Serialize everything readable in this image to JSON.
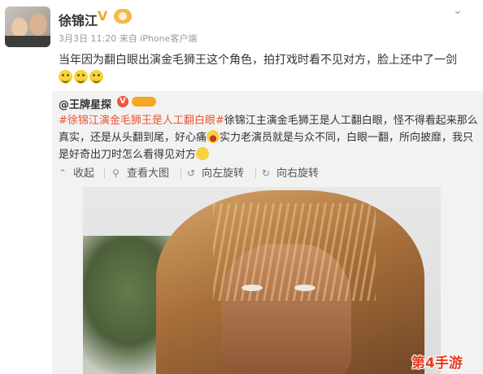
{
  "post": {
    "user_name": "徐锦江",
    "meta": "3月3日 11:20 来自 iPhone客户端",
    "text": "当年因为翻白眼出演金毛狮王这个角色，拍打戏时看不见对方，脸上还中了一剑",
    "emoji_count": 3
  },
  "repost": {
    "author": "@王牌星探",
    "topic": "#徐锦江演金毛狮王是人工翻白眼#",
    "text_1": "徐锦江主演金毛狮王是人工翻白眼，怪不得看起来那么真实，还是从头翻到尾，好心痛",
    "text_2": "实力老演员就是与众不同，白眼一翻，所向披靡，我只是好奇出刀时怎么看得见对方"
  },
  "actions": [
    {
      "icon": "collapse-icon",
      "label": "收起"
    },
    {
      "icon": "zoom-icon",
      "label": "查看大图"
    },
    {
      "icon": "rotate-left-icon",
      "label": "向左旋转"
    },
    {
      "icon": "rotate-right-icon",
      "label": "向右旋转"
    }
  ],
  "watermark": "第4手游",
  "colors": {
    "topic": "#e9572f",
    "watermark": "#e53a1f",
    "v_badge": "#f5a623"
  }
}
